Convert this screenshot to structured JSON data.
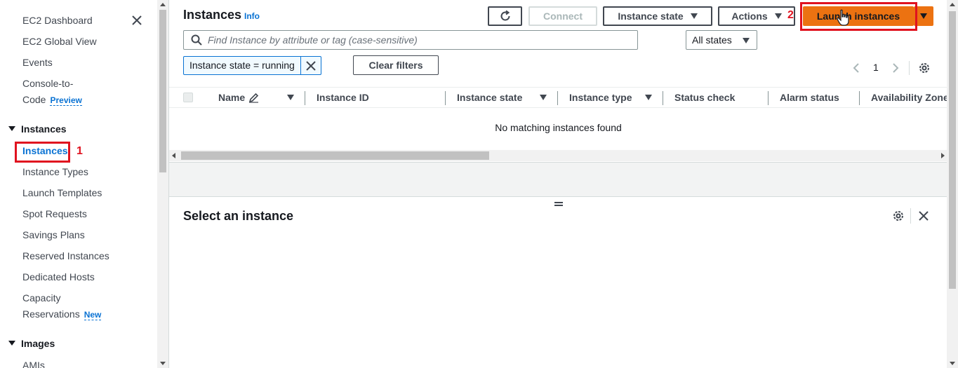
{
  "sidebar": {
    "top_items": [
      {
        "label": "EC2 Dashboard"
      },
      {
        "label": "EC2 Global View"
      },
      {
        "label": "Events"
      }
    ],
    "console_to_code": {
      "line1": "Console-to-",
      "line2": "Code",
      "badge": "Preview"
    },
    "instances_section": "Instances",
    "instances_items": [
      {
        "label": "Instances",
        "active": true
      },
      {
        "label": "Instance Types"
      },
      {
        "label": "Launch Templates"
      },
      {
        "label": "Spot Requests"
      },
      {
        "label": "Savings Plans"
      },
      {
        "label": "Reserved Instances"
      },
      {
        "label": "Dedicated Hosts"
      }
    ],
    "capacity": {
      "line1": "Capacity",
      "line2": "Reservations",
      "badge": "New"
    },
    "images_section": "Images",
    "images_items": [
      {
        "label": "AMIs"
      }
    ]
  },
  "annotations": {
    "step1": "1",
    "step2": "2"
  },
  "header": {
    "title": "Instances",
    "info": "Info",
    "connect": "Connect",
    "instance_state": "Instance state",
    "actions": "Actions",
    "launch": "Launch instances"
  },
  "search": {
    "placeholder": "Find Instance by attribute or tag (case-sensitive)"
  },
  "states_select": "All states",
  "filter_token": "Instance state = running",
  "clear_filters": "Clear filters",
  "pagination": {
    "page": "1"
  },
  "table": {
    "columns": [
      "Name",
      "Instance ID",
      "Instance state",
      "Instance type",
      "Status check",
      "Alarm status",
      "Availability Zone"
    ],
    "empty_message": "No matching instances found"
  },
  "details": {
    "title": "Select an instance"
  },
  "colors": {
    "accent": "#ec7211",
    "link": "#0972d3",
    "annotation": "#e0121f"
  }
}
